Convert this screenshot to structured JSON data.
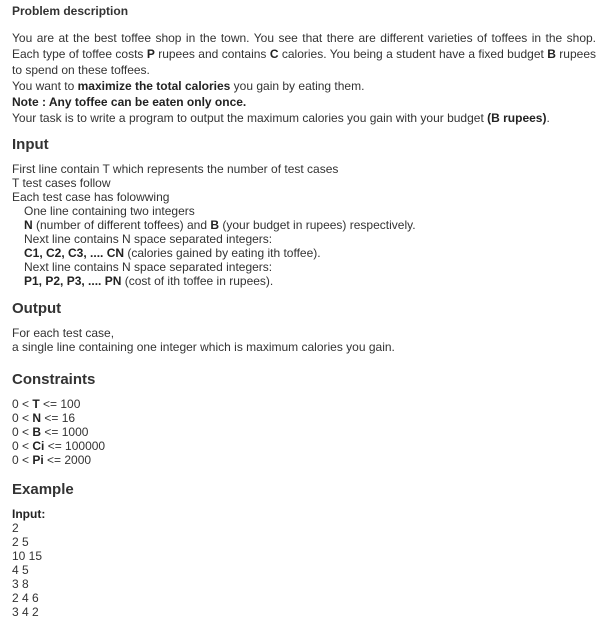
{
  "main_title": "Problem description",
  "description": {
    "p1_text1": "You are at the best toffee shop in the town. You see that there are different varieties of toffees in the shop. Each type of toffee costs ",
    "p1_bold_p": "P",
    "p1_text2": " rupees and contains ",
    "p1_bold_c": "C",
    "p1_text3": " calories. You being a student have a fixed budget ",
    "p1_bold_b": "B",
    "p1_text4": " rupees to spend on these toffees.",
    "p2_text1": "You want to ",
    "p2_bold": "maximize the total calories",
    "p2_text2": " you gain by eating them.",
    "note": "Note : Any toffee can be eaten only once.",
    "p3_text1": "Your task is to write a program to output the maximum calories you gain with your budget ",
    "p3_bold": "(B rupees)",
    "p3_text2": "."
  },
  "input_section": {
    "title": "Input",
    "line1": "First line contain T which represents the number of test cases",
    "line2": "T test cases follow",
    "line3": "Each test case has folowwing",
    "line4": "One line containing two integers",
    "line5_bold_n": "N",
    "line5_text1": " (number of different toffees) and ",
    "line5_bold_b": "B",
    "line5_text2": " (your budget in rupees) respectively.",
    "line6": "Next line contains N space separated integers:",
    "line7_bold": "C1, C2, C3, .... CN",
    "line7_text": " (calories gained by eating ith toffee).",
    "line8": "Next line contains N space separated integers:",
    "line9_bold": "P1, P2, P3, .... PN",
    "line9_text": " (cost of ith toffee in rupees)."
  },
  "output_section": {
    "title": "Output",
    "line1": "For each test case,",
    "line2": "a single line containing one integer which is maximum calories you gain."
  },
  "constraints_section": {
    "title": "Constraints",
    "items": [
      {
        "pre": "0 < ",
        "var": "T",
        "post": " <= 100"
      },
      {
        "pre": "0 < ",
        "var": "N",
        "post": " <= 16"
      },
      {
        "pre": "0 < ",
        "var": "B",
        "post": " <= 1000"
      },
      {
        "pre": "0 < ",
        "var": "Ci",
        "post": " <= 100000"
      },
      {
        "pre": "0 < ",
        "var": "Pi",
        "post": " <= 2000"
      }
    ]
  },
  "example_section": {
    "title": "Example",
    "input_label": "Input:",
    "lines": [
      "2",
      "2 5",
      "10 15",
      "4 5",
      "3 8",
      "2 4 6",
      "3 4 2"
    ]
  }
}
